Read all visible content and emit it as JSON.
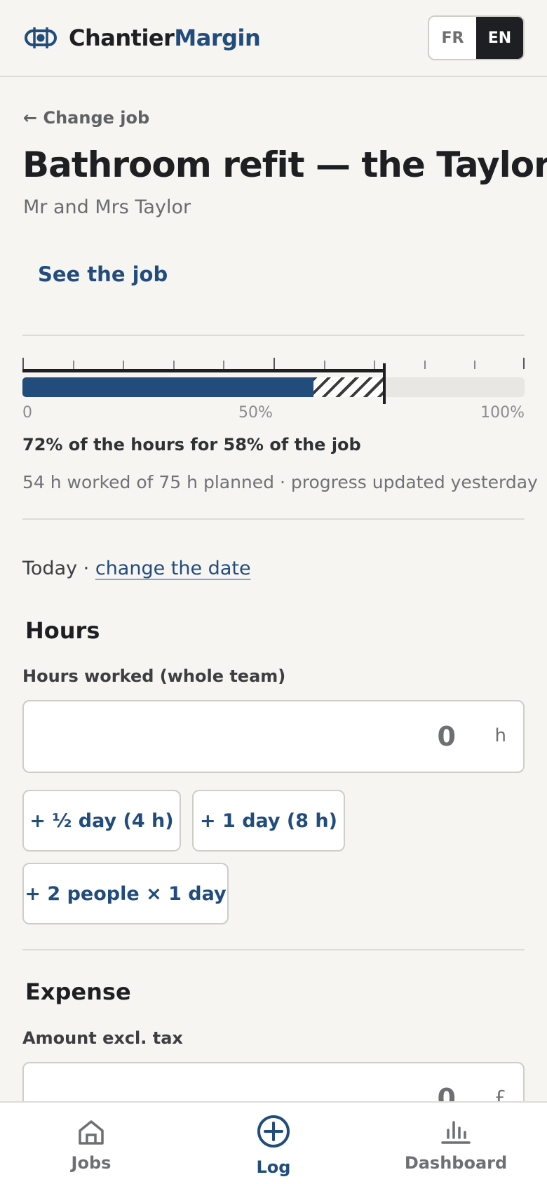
{
  "brand": {
    "part1": "Chantier",
    "part2": "Margin"
  },
  "language": {
    "fr_label": "FR",
    "en_label": "EN",
    "selected": "EN"
  },
  "nav_back": "← Change job",
  "job": {
    "title": "Bathroom refit — the Taylors",
    "client": "Mr and Mrs Taylor",
    "see_job_label": "See the job"
  },
  "progress": {
    "hours_fraction": 0.72,
    "job_completion_fraction": 0.58,
    "scale_start": "0",
    "scale_mid": "50%",
    "scale_end": "100%",
    "summary": "72% of the hours for 58% of the job",
    "detail": "54 h worked of 75 h planned · progress updated yesterday"
  },
  "date": {
    "prefix": "Today · ",
    "change_link": "change the date"
  },
  "hours_section": {
    "heading": "Hours",
    "field_label": "Hours worked (whole team)",
    "value": "0",
    "unit": "h",
    "quick_adds": [
      "+ ½ day (4 h)",
      "+ 1 day (8 h)",
      "+ 2 people × 1 day"
    ]
  },
  "expense_section": {
    "heading": "Expense",
    "field_label": "Amount excl. tax",
    "value": "0",
    "unit": "£"
  },
  "bottom_nav": {
    "items": [
      {
        "label": "Jobs",
        "icon": "house-icon"
      },
      {
        "label": "Log",
        "icon": "plus-circle-icon",
        "active": true
      },
      {
        "label": "Dashboard",
        "icon": "bar-chart-icon"
      }
    ]
  },
  "colors": {
    "accent": "#214c7c",
    "text": "#1d1f22",
    "background": "#f6f5f2"
  }
}
